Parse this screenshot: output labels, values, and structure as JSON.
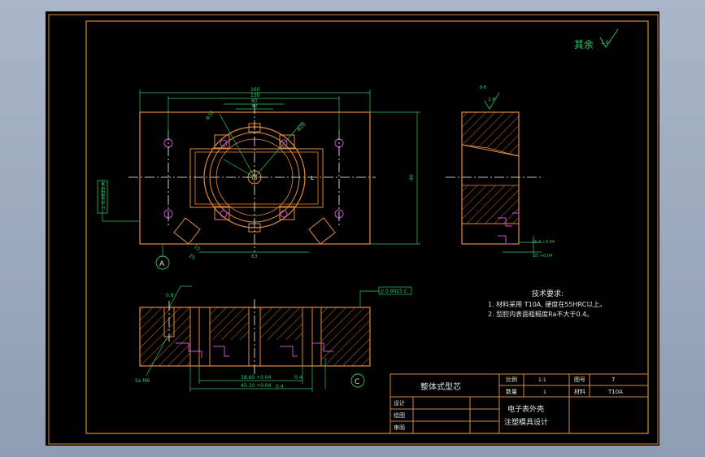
{
  "drawing": {
    "roughness_note": "其余",
    "roughness_value": "1.6",
    "section_label": "B-B",
    "section_roughness": "1.6",
    "hole_label_bottom": "0.8",
    "thread_label": "Sx M6",
    "flatness_callout": "// 0.0025 C",
    "flatness_callout_left": "⊥ 0.0025 A",
    "datum_a": "A",
    "datum_c": "C"
  },
  "dimensions": {
    "top_160": "160",
    "top_130": "130",
    "top_80": "80",
    "top_40": "40",
    "right_90": "90",
    "bottom_63": "63",
    "left_25": "25",
    "left_15": "15",
    "bottom_38": "38.60 +0.04",
    "bottom_45": "45.10 +0.04",
    "bottom_04a": "0.4",
    "bottom_04b": "0.4",
    "side_154": "15.4 +0.04",
    "side_25": "25 +0.04",
    "diam_1": "Φ32",
    "diam_2": "Φ28",
    "label_L": "L"
  },
  "tech_requirements": {
    "title": "技术要求:",
    "item1": "1. 材料采用 T10A, 硬度在55HRC以上。",
    "item2": "2. 型腔内表面粗糙度Ra不大于0.4。"
  },
  "title_block": {
    "part_name": "整体式型芯",
    "scale_label": "比例",
    "scale_value": "1:1",
    "drawing_no_label": "图号",
    "drawing_no_value": "7",
    "quantity_label": "数量",
    "quantity_value": "1",
    "material_label": "材料",
    "material_value": "T10A",
    "designer_label": "设计",
    "drafter_label": "绘图",
    "reviewer_label": "审阅",
    "project_line1": "电子表外壳",
    "project_line2": "注塑模具设计"
  },
  "colors": {
    "frame": "#d68a3a",
    "part": "#e58a3c",
    "dimension": "#34c46a",
    "centerline": "#ffffff",
    "hatch": "#c86e2e",
    "magenta": "#d24bd6",
    "text": "#dfe7e0"
  }
}
